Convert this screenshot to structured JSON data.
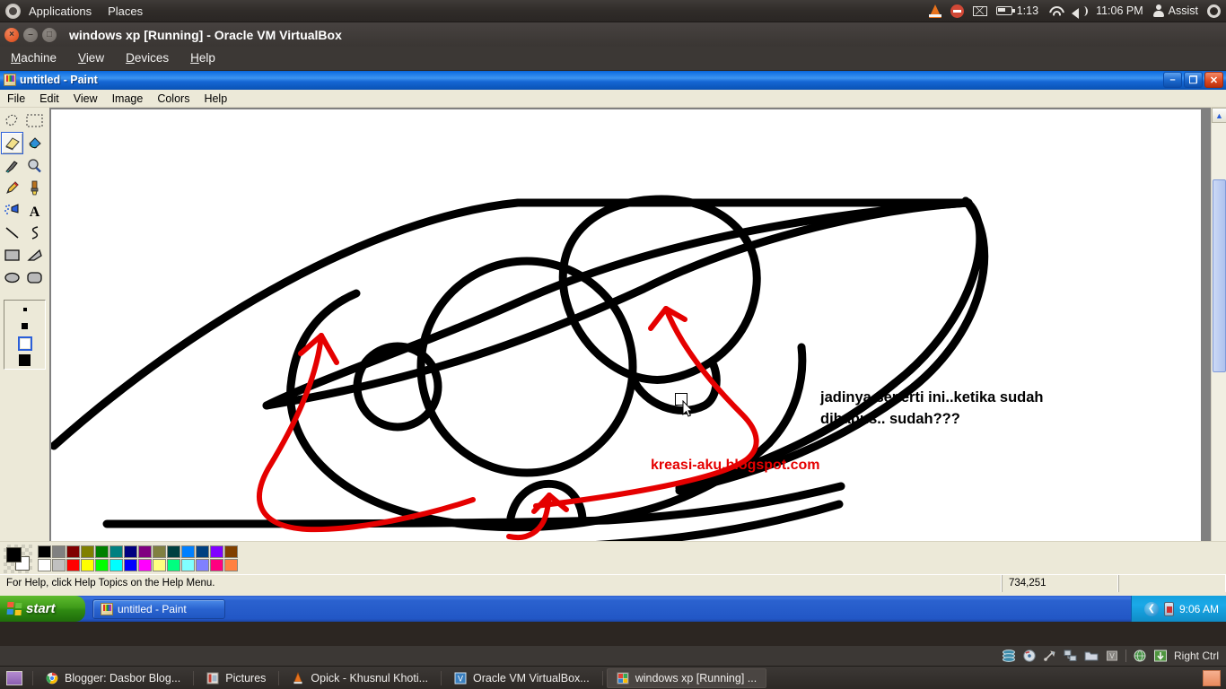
{
  "ubuntu_panel": {
    "logo_icon": "ubuntu-logo-icon",
    "menus": [
      {
        "label": "Applications"
      },
      {
        "label": "Places"
      }
    ],
    "tray": {
      "vlc_icon": "vlc-cone-icon",
      "dnd_icon": "do-not-disturb-icon",
      "mail_icon": "mail-envelope-icon",
      "battery_icon": "battery-icon",
      "battery_time": "1:13",
      "wifi_icon": "wifi-icon",
      "volume_icon": "volume-speaker-icon",
      "clock": "11:06 PM",
      "user_icon": "user-person-icon",
      "user_label": "Assist",
      "settings_icon": "gear-icon"
    }
  },
  "virtualbox": {
    "window_title": "windows xp [Running] - Oracle VM VirtualBox",
    "close_glyph": "×",
    "min_glyph": "–",
    "max_glyph": "□",
    "menus": [
      {
        "label": "Machine",
        "accel": "M",
        "rest": "achine"
      },
      {
        "label": "View",
        "accel": "V",
        "rest": "iew"
      },
      {
        "label": "Devices",
        "accel": "D",
        "rest": "evices"
      },
      {
        "label": "Help",
        "accel": "H",
        "rest": "elp"
      }
    ],
    "status": {
      "host_key": "Right Ctrl",
      "icons": [
        "hard-disk-icon",
        "cd-dvd-icon",
        "usb-icon",
        "network-icon",
        "shared-folder-icon",
        "cpu-icon",
        "globe-icon",
        "download-icon"
      ]
    }
  },
  "paint": {
    "title": "untitled - Paint",
    "app_icon": "paint-palette-icon",
    "window_buttons": {
      "minimize": "–",
      "restore": "❐",
      "close": "✕"
    },
    "menus": [
      {
        "label": "File"
      },
      {
        "label": "Edit"
      },
      {
        "label": "View"
      },
      {
        "label": "Image"
      },
      {
        "label": "Colors"
      },
      {
        "label": "Help"
      }
    ],
    "tools": [
      {
        "name": "free-form-select-tool",
        "selected": false
      },
      {
        "name": "rectangular-select-tool",
        "selected": false
      },
      {
        "name": "eraser-tool",
        "selected": true
      },
      {
        "name": "fill-with-color-tool",
        "selected": false
      },
      {
        "name": "pick-color-tool",
        "selected": false
      },
      {
        "name": "magnifier-tool",
        "selected": false
      },
      {
        "name": "pencil-tool",
        "selected": false
      },
      {
        "name": "brush-tool",
        "selected": false
      },
      {
        "name": "airbrush-tool",
        "selected": false
      },
      {
        "name": "text-tool",
        "selected": false
      },
      {
        "name": "line-tool",
        "selected": false
      },
      {
        "name": "curve-tool",
        "selected": false
      },
      {
        "name": "rectangle-tool",
        "selected": false
      },
      {
        "name": "polygon-tool",
        "selected": false
      },
      {
        "name": "ellipse-tool",
        "selected": false
      },
      {
        "name": "rounded-rectangle-tool",
        "selected": false
      }
    ],
    "eraser_sizes": [
      {
        "size": 5,
        "selected": false
      },
      {
        "size": 8,
        "selected": false
      },
      {
        "size": 12,
        "selected": true
      },
      {
        "size": 14,
        "selected": false
      }
    ],
    "status": {
      "help_text": "For Help, click Help Topics on the Help Menu.",
      "coordinates": "734,251"
    },
    "colors": {
      "foreground": "#000000",
      "background": "#ffffff",
      "row1": [
        "#000000",
        "#808080",
        "#800000",
        "#808000",
        "#008000",
        "#008080",
        "#000080",
        "#800080",
        "#808040",
        "#004040",
        "#0080ff",
        "#004080",
        "#8000ff",
        "#804000"
      ],
      "row2": [
        "#ffffff",
        "#c0c0c0",
        "#ff0000",
        "#ffff00",
        "#00ff00",
        "#00ffff",
        "#0000ff",
        "#ff00ff",
        "#ffff80",
        "#00ff80",
        "#80ffff",
        "#8080ff",
        "#ff0080",
        "#ff8040"
      ]
    },
    "canvas": {
      "annotation_black_line1": "jadinya seperti ini..ketika sudah",
      "annotation_black_line2": "dihapus.. sudah???",
      "watermark_red": "kreasi-aku.blogspot.com",
      "drawing_subject": "eye-line-drawing",
      "stroke_color": "#000000",
      "arrow_color": "#e50000",
      "cursor_icon": "eraser-cursor"
    },
    "scrollbars": {
      "up_arrow": "▲",
      "down_arrow": "▼",
      "left_arrow": "◀",
      "right_arrow": "▶"
    }
  },
  "xp_taskbar": {
    "start_label": "start",
    "start_icon": "windows-flag-icon",
    "tasks": [
      {
        "label": "untitled - Paint",
        "icon": "paint-palette-icon",
        "active": true
      }
    ],
    "tray": {
      "chevron_icon": "show-hidden-icons-chevron",
      "battery_icon": "battery-tray-icon",
      "clock": "9:06 AM"
    }
  },
  "ubuntu_bottom": {
    "show_desktop_icon": "show-desktop-icon",
    "tasks": [
      {
        "label": "Blogger: Dasbor Blog...",
        "icon": "chrome-icon",
        "active": false
      },
      {
        "label": "Pictures",
        "icon": "folder-pictures-icon",
        "active": false
      },
      {
        "label": "Opick - Khusnul Khoti...",
        "icon": "vlc-cone-icon",
        "active": false
      },
      {
        "label": "Oracle VM VirtualBox...",
        "icon": "virtualbox-icon",
        "active": false
      },
      {
        "label": "windows xp [Running] ...",
        "icon": "virtualbox-vm-icon",
        "active": true
      }
    ],
    "tray_icon": "vm-preview-icon"
  }
}
